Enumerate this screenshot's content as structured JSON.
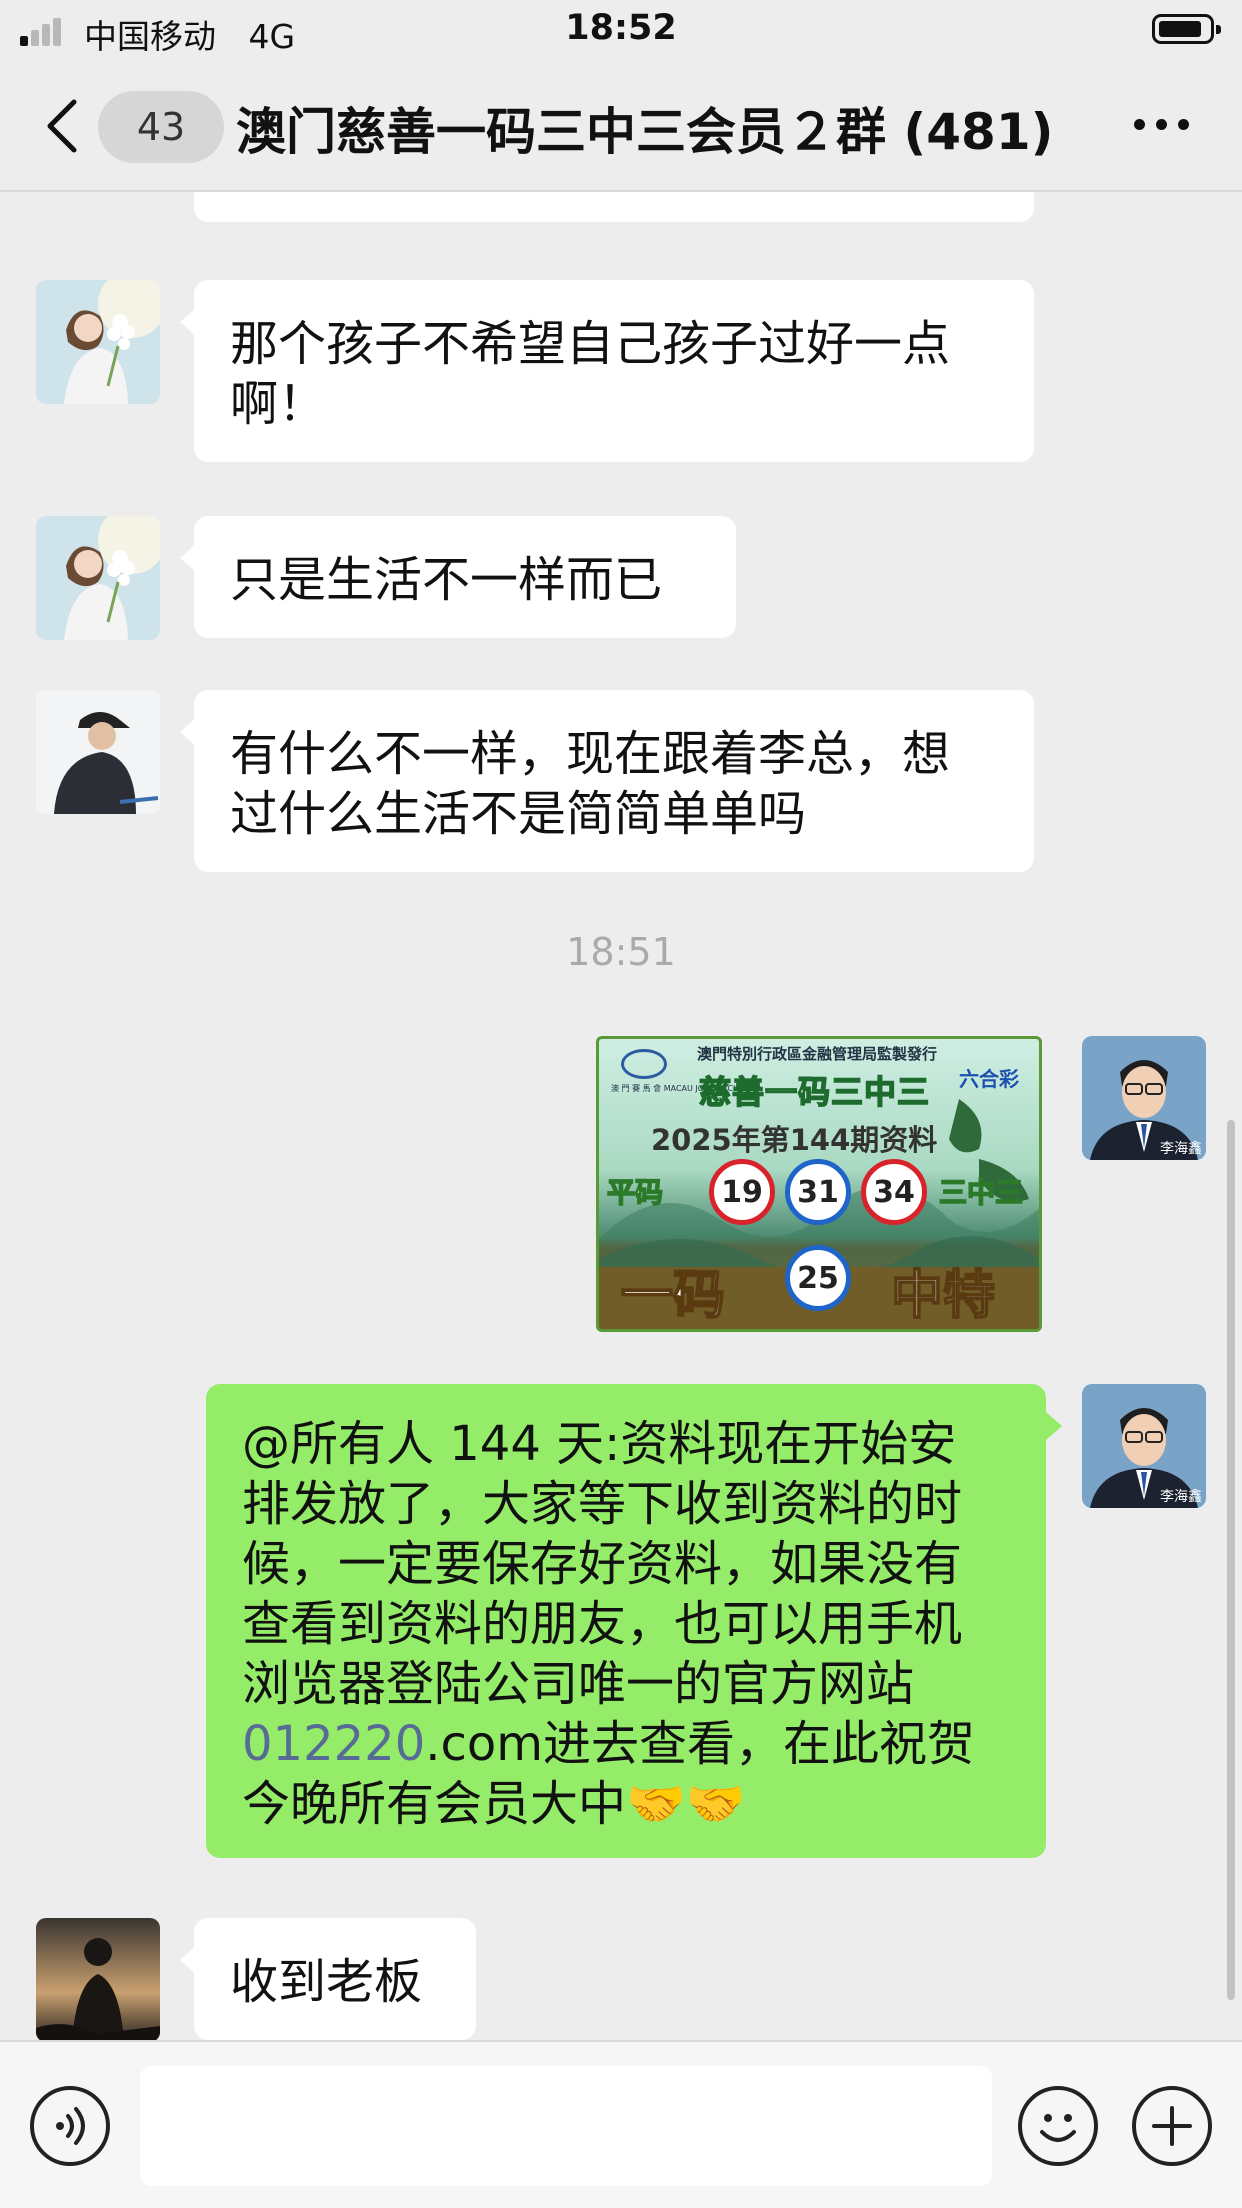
{
  "status_bar": {
    "carrier": "中国移动",
    "network": "4G",
    "time": "18:52"
  },
  "header": {
    "back_badge": "43",
    "title": "澳门慈善一码三中三会员２群 (481)"
  },
  "messages": [
    {
      "side": "left",
      "avatar": "woman-with-flowers-avatar",
      "text_lines": [
        "那个孩子不希望自己孩子过好一点",
        "啊！"
      ]
    },
    {
      "side": "left",
      "avatar": "woman-with-flowers-avatar",
      "text_lines": [
        "只是生活不一样而已"
      ]
    },
    {
      "side": "left",
      "avatar": "man-in-cap-avatar",
      "text_lines": [
        "有什么不一样，现在跟着李总，想",
        "过什么生活不是简简单单吗"
      ]
    },
    {
      "type": "timestamp",
      "text": "18:51"
    },
    {
      "side": "right",
      "avatar": "man-in-suit-avatar",
      "avatar_caption": "李海鑫",
      "type": "image"
    },
    {
      "side": "right",
      "avatar": "man-in-suit-avatar",
      "avatar_caption": "李海鑫",
      "text_lines": [
        "@所有人 144 天:资料现在开始安",
        "排发放了，大家等下收到资料的时",
        "候，一定要保存好资料，如果没有",
        "查看到资料的朋友，也可以用手机",
        "浏览器登陆公司唯一的官方网站"
      ],
      "link": "012220",
      "link_suffix": ".com进去查看，在此祝贺",
      "last_line": "今晚所有会员大中🤝🤝"
    },
    {
      "side": "left",
      "avatar": "silhouette-avatar",
      "text_lines": [
        "收到老板"
      ]
    }
  ],
  "lottery_image": {
    "org": "澳門特別行政區金融管理局監製發行",
    "logo_text": "澳 門 賽 馬 會 MACAU JOCKEY CLUB",
    "brand": "六合彩",
    "title": "慈善一码三中三",
    "period": "2025年第144期资料",
    "label_left": "平码",
    "label_right": "三中三",
    "balls": [
      "19",
      "31",
      "34"
    ],
    "bottom_left": "一码",
    "special_ball": "25",
    "bottom_right": "中特"
  },
  "colors": {
    "background": "#ededed",
    "bubble_self": "#95ec69",
    "bubble_other": "#ffffff",
    "link": "#576b95",
    "timestamp": "#aaaaaa"
  },
  "input_bar": {
    "voice_icon": "voice-icon",
    "emoji_icon": "emoji-icon",
    "plus_icon": "plus-icon"
  }
}
